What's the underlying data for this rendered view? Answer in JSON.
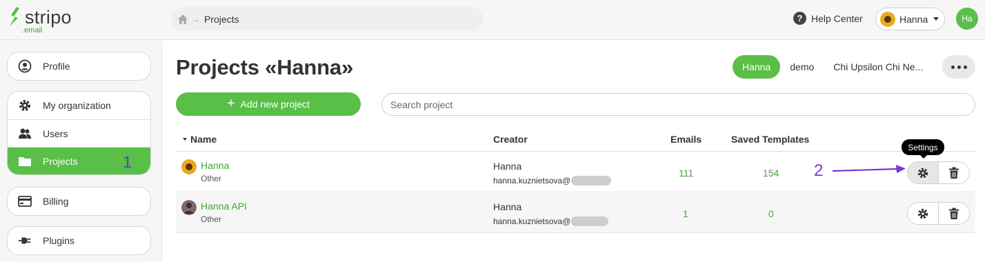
{
  "brand": {
    "name": "stripo",
    "sub": ".email"
  },
  "breadcrumb": {
    "current": "Projects"
  },
  "header": {
    "help_label": "Help Center",
    "user_name": "Hanna",
    "avatar_initials": "Ha"
  },
  "sidebar": {
    "items": [
      {
        "label": "Profile",
        "icon": "user-circle-icon"
      },
      {
        "label": "My organization",
        "icon": "gear-icon"
      },
      {
        "label": "Users",
        "icon": "users-icon"
      },
      {
        "label": "Projects",
        "icon": "folder-icon",
        "active": true
      },
      {
        "label": "Billing",
        "icon": "credit-card-icon"
      },
      {
        "label": "Plugins",
        "icon": "plug-icon"
      }
    ],
    "annotation": "1"
  },
  "page": {
    "title_prefix": "Projects «",
    "title_name": "Hanna",
    "title_suffix": "»"
  },
  "project_tabs": [
    "Hanna",
    "demo",
    "Chi Upsilon Chi Ne..."
  ],
  "actions": {
    "add_project": "Add new project",
    "search_placeholder": "Search project"
  },
  "table": {
    "columns": {
      "name": "Name",
      "creator": "Creator",
      "emails": "Emails",
      "saved": "Saved Templates"
    },
    "rows": [
      {
        "name": "Hanna",
        "type": "Other",
        "creator": "Hanna",
        "email": "hanna.kuznietsova@",
        "emails": "111",
        "saved": "154"
      },
      {
        "name": "Hanna API",
        "type": "Other",
        "creator": "Hanna",
        "email": "hanna.kuznietsova@",
        "emails": "1",
        "saved": "0"
      }
    ]
  },
  "tooltip": "Settings",
  "annotation_2": "2",
  "colors": {
    "accent": "#59bf47",
    "link": "#46a338",
    "annotation": "#7b35d6"
  }
}
